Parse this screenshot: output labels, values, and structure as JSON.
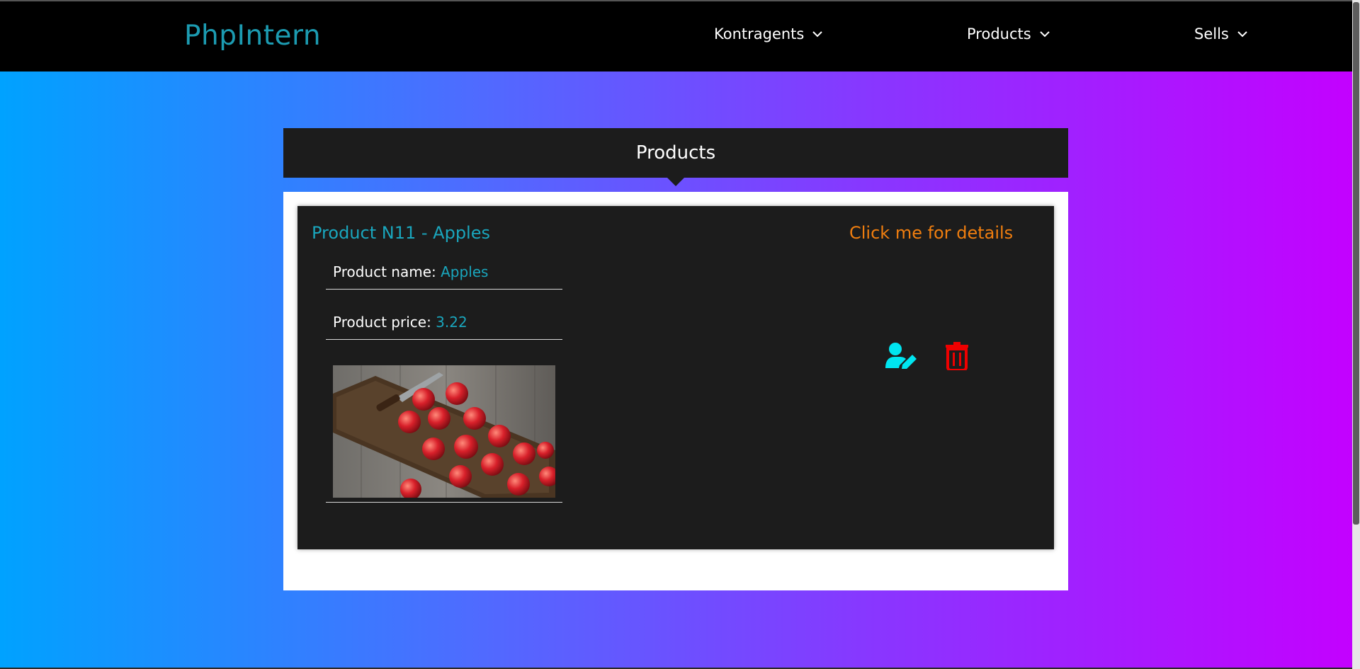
{
  "brand": "PhpIntern",
  "nav": {
    "items": [
      {
        "label": "Kontragents"
      },
      {
        "label": "Products"
      },
      {
        "label": "Sells"
      }
    ]
  },
  "page": {
    "title": "Products"
  },
  "product_card": {
    "title": "Product N11 - Apples",
    "details_link": "Click me for details",
    "name_label": "Product name:",
    "name_value": "Apples",
    "price_label": "Product price:",
    "price_value": "3.22",
    "image_subject": "apples on cutting board with knife"
  },
  "icons": {
    "edit": "user-edit-icon",
    "delete": "trash-icon",
    "nav_dropdown": "chevron-down-icon"
  },
  "colors": {
    "brand": "#1c9bb1",
    "accent_teal": "#1aa6bd",
    "details_orange": "#f07e0f",
    "edit_cyan": "#00e5f0",
    "delete_red": "#ee0000",
    "card_bg": "#1c1c1c",
    "gradient_start": "#00a2ff",
    "gradient_end": "#c400ff"
  }
}
